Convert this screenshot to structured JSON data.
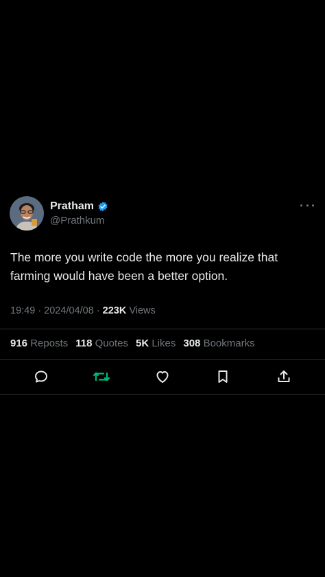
{
  "tweet": {
    "display_name": "Pratham",
    "handle": "@Prathkum",
    "text": "The more you write code the more you realize that farming would have been a better option.",
    "time": "19:49",
    "date": "2024/04/08",
    "views_count": "223K",
    "views_label": "Views",
    "stats": {
      "reposts": {
        "count": "916",
        "label": "Reposts"
      },
      "quotes": {
        "count": "118",
        "label": "Quotes"
      },
      "likes": {
        "count": "5K",
        "label": "Likes"
      },
      "bookmarks": {
        "count": "308",
        "label": "Bookmarks"
      }
    },
    "icons": {
      "verified": "verified-badge-icon",
      "more": "more-icon",
      "reply": "reply-icon",
      "repost": "repost-icon",
      "like": "like-icon",
      "bookmark": "bookmark-icon",
      "share": "share-icon"
    }
  },
  "colors": {
    "background": "#000000",
    "text_primary": "#e7e9ea",
    "text_secondary": "#71767b",
    "verified": "#1d9bf0",
    "repost_active": "#00ba7c",
    "divider": "#2f3336"
  }
}
